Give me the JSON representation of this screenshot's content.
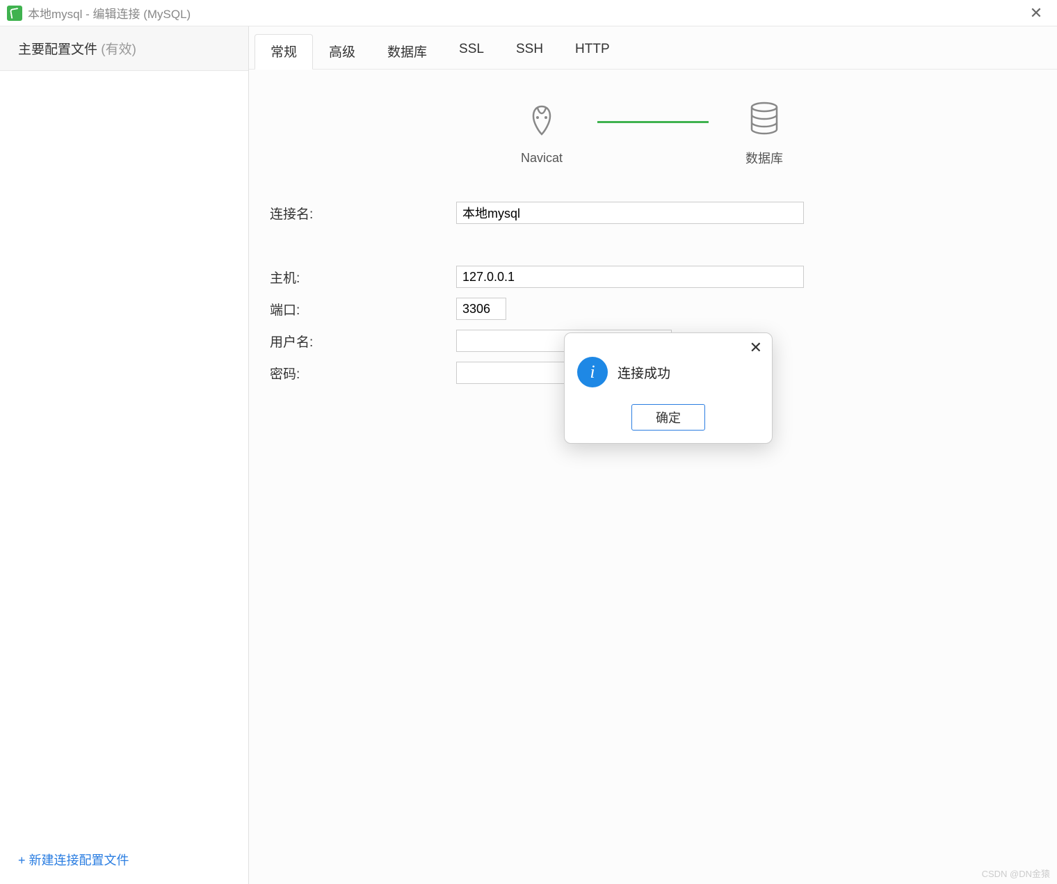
{
  "titlebar": {
    "title": "本地mysql - 编辑连接 (MySQL)"
  },
  "sidebar": {
    "header_label": "主要配置文件",
    "header_suffix": "(有效)",
    "new_profile_label": "+ 新建连接配置文件"
  },
  "tabs": [
    {
      "label": "常规",
      "active": true
    },
    {
      "label": "高级",
      "active": false
    },
    {
      "label": "数据库",
      "active": false
    },
    {
      "label": "SSL",
      "active": false
    },
    {
      "label": "SSH",
      "active": false
    },
    {
      "label": "HTTP",
      "active": false
    }
  ],
  "diagram": {
    "left_label": "Navicat",
    "right_label": "数据库"
  },
  "form": {
    "connection_name": {
      "label": "连接名:",
      "value": "本地mysql"
    },
    "host": {
      "label": "主机:",
      "value": "127.0.0.1"
    },
    "port": {
      "label": "端口:",
      "value": "3306"
    },
    "username": {
      "label": "用户名:",
      "value": ""
    },
    "password": {
      "label": "密码:",
      "value": ""
    }
  },
  "dialog": {
    "message": "连接成功",
    "ok_label": "确定"
  },
  "watermark": "CSDN @DN金猿"
}
